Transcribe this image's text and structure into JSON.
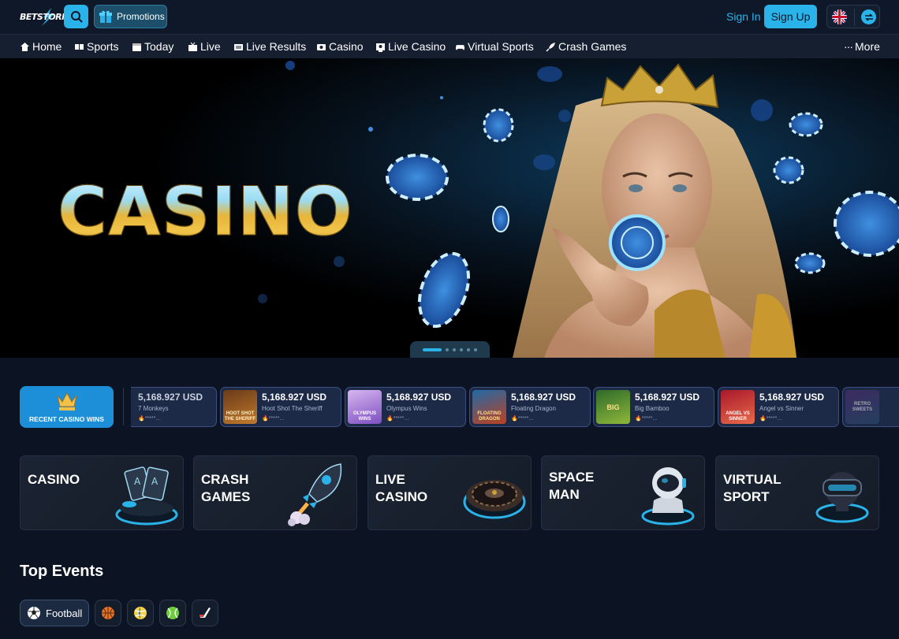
{
  "brand": {
    "logo_text": "BETSTORM"
  },
  "header": {
    "promotions_label": "Promotions",
    "signin_label": "Sign In",
    "signup_label": "Sign Up",
    "language_flag_icon": "uk-flag-icon",
    "settings_icon": "odds-settings-icon"
  },
  "nav": {
    "items": [
      {
        "label": "Home",
        "icon": "home-icon"
      },
      {
        "label": "Sports",
        "icon": "sports-icon"
      },
      {
        "label": "Today",
        "icon": "calendar-icon"
      },
      {
        "label": "Live",
        "icon": "live-icon"
      },
      {
        "label": "Live Results",
        "icon": "results-icon"
      },
      {
        "label": "Casino",
        "icon": "casino-icon"
      },
      {
        "label": "Live Casino",
        "icon": "live-casino-icon"
      },
      {
        "label": "Virtual Sports",
        "icon": "gamepad-icon"
      },
      {
        "label": "Crash Games",
        "icon": "rocket-icon"
      }
    ],
    "more_label": "More"
  },
  "hero": {
    "title": "CASINO",
    "slides": 6,
    "active_slide": 1
  },
  "wins": {
    "label": "RECENT CASINO WINS",
    "items": [
      {
        "amount": "5,168.927 USD",
        "game": "7 Monkeys",
        "user": "*****...",
        "thumb": "Hoot Shot The Sheriff",
        "thumb_text": ""
      },
      {
        "amount": "5,168.927 USD",
        "game": "Hoot Shot The Sheriff",
        "user": "*****...",
        "thumb_text": "HOOT SHOT THE SHERIFF"
      },
      {
        "amount": "5,168.927 USD",
        "game": "Olympus Wins",
        "user": "*****...",
        "thumb_text": "OLYMPUS WINS"
      },
      {
        "amount": "5,168.927 USD",
        "game": "Floating Dragon",
        "user": "*****...",
        "thumb_text": "FLOATING DRAGON"
      },
      {
        "amount": "5,168.927 USD",
        "game": "Big Bamboo",
        "user": "*****...",
        "thumb_text": "BIG"
      },
      {
        "amount": "5,168.927 USD",
        "game": "Angel vs Sinner",
        "user": "*****...",
        "thumb_text": "ANGEL VS SINNER"
      },
      {
        "amount": "",
        "game": "",
        "user": "",
        "thumb_text": "RETRO SWEETS"
      }
    ]
  },
  "categories": [
    {
      "line1": "CASINO",
      "line2": "",
      "icon": "casino-cards-icon"
    },
    {
      "line1": "CRASH",
      "line2": "GAMES",
      "icon": "rocket-icon"
    },
    {
      "line1": "LIVE",
      "line2": "CASINO",
      "icon": "roulette-icon"
    },
    {
      "line1": "SPACE",
      "line2": "MAN",
      "icon": "astronaut-icon"
    },
    {
      "line1": "VIRTUAL",
      "line2": "SPORT",
      "icon": "vr-headset-icon"
    }
  ],
  "top_events": {
    "title": "Top Events",
    "tabs": [
      {
        "label": "Football",
        "icon": "football-icon"
      },
      {
        "label": "",
        "icon": "basketball-icon"
      },
      {
        "label": "",
        "icon": "volleyball-icon"
      },
      {
        "label": "",
        "icon": "tennis-icon"
      },
      {
        "label": "",
        "icon": "ice-hockey-icon"
      }
    ]
  },
  "colors": {
    "accent": "#2ab3e8",
    "background": "#0c1424",
    "card": "#1c2a48"
  }
}
